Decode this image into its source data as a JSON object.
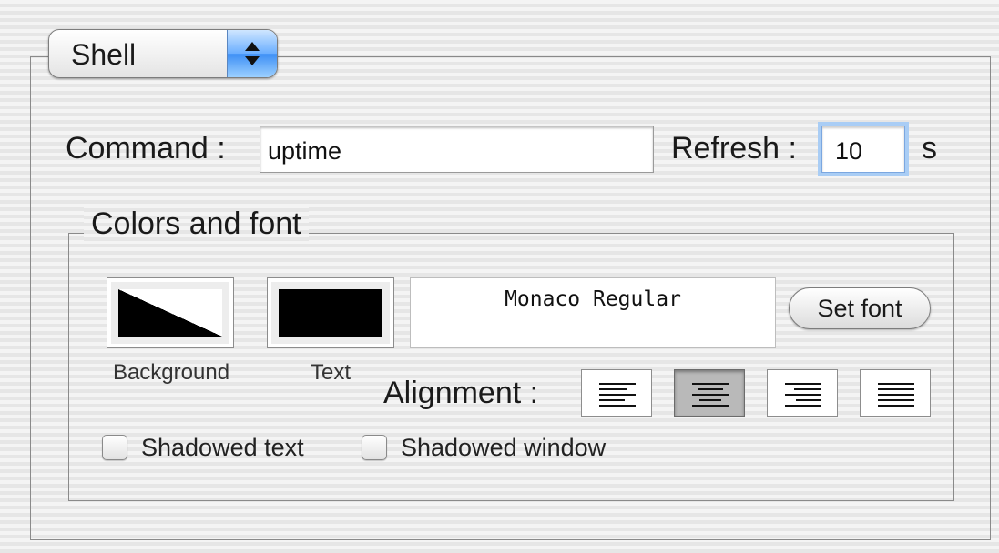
{
  "popup": {
    "selected": "Shell"
  },
  "command": {
    "label": "Command :",
    "value": "uptime"
  },
  "refresh": {
    "label": "Refresh :",
    "value": "10",
    "unit": "s"
  },
  "colors_and_font": {
    "title": "Colors and font",
    "background_label": "Background",
    "text_label": "Text",
    "background_colors": [
      "#000000",
      "#ffffff"
    ],
    "text_color": "#000000",
    "font_preview": "Monaco Regular",
    "set_font_label": "Set font",
    "alignment_label": "Alignment :",
    "alignment_options": [
      "left-align-icon",
      "center-align-icon",
      "right-align-icon",
      "justify-align-icon"
    ],
    "alignment_selected": "center"
  },
  "options": {
    "shadowed_text": {
      "label": "Shadowed text",
      "checked": false
    },
    "shadowed_window": {
      "label": "Shadowed window",
      "checked": false
    }
  }
}
